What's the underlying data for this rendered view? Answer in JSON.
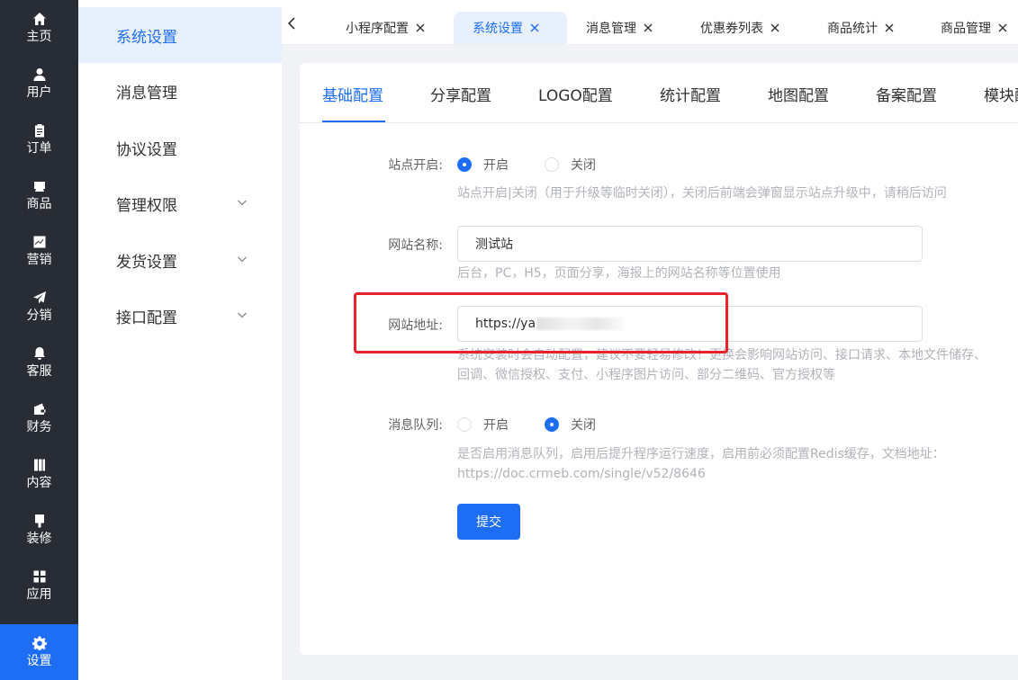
{
  "rail": {
    "items": [
      {
        "label": "主页",
        "icon": "home-icon"
      },
      {
        "label": "用户",
        "icon": "user-icon"
      },
      {
        "label": "订单",
        "icon": "clipboard-icon"
      },
      {
        "label": "商品",
        "icon": "product-icon"
      },
      {
        "label": "营销",
        "icon": "chart-icon"
      },
      {
        "label": "分销",
        "icon": "paper-plane-icon"
      },
      {
        "label": "客服",
        "icon": "bell-icon"
      },
      {
        "label": "财务",
        "icon": "wallet-icon"
      },
      {
        "label": "内容",
        "icon": "book-icon"
      },
      {
        "label": "装修",
        "icon": "brush-icon"
      },
      {
        "label": "应用",
        "icon": "apps-grid-icon"
      },
      {
        "label": "设置",
        "icon": "gear-icon",
        "active": true
      }
    ]
  },
  "submenu": {
    "items": [
      {
        "label": "系统设置",
        "active": true
      },
      {
        "label": "消息管理"
      },
      {
        "label": "协议设置"
      },
      {
        "label": "管理权限",
        "expandable": true
      },
      {
        "label": "发货设置",
        "expandable": true
      },
      {
        "label": "接口配置",
        "expandable": true
      }
    ]
  },
  "tabs": [
    {
      "label": "小程序配置"
    },
    {
      "label": "系统设置",
      "active": true
    },
    {
      "label": "消息管理"
    },
    {
      "label": "优惠券列表"
    },
    {
      "label": "商品统计"
    },
    {
      "label": "商品管理"
    }
  ],
  "config_tabs": [
    {
      "label": "基础配置",
      "active": true
    },
    {
      "label": "分享配置"
    },
    {
      "label": "LOGO配置"
    },
    {
      "label": "统计配置"
    },
    {
      "label": "地图配置"
    },
    {
      "label": "备案配置"
    },
    {
      "label": "模块配"
    }
  ],
  "form": {
    "site_open": {
      "label": "站点开启:",
      "options": [
        "开启",
        "关闭"
      ],
      "selected": "开启",
      "hint": "站点开启|关闭（用于升级等临时关闭），关闭后前端会弹窗显示站点升级中，请稍后访问"
    },
    "site_name": {
      "label": "网站名称:",
      "value": "测试站",
      "hint": "后台，PC，H5，页面分享，海报上的网站名称等位置使用"
    },
    "site_url": {
      "label": "网站地址:",
      "value": "https://ya",
      "hint_line1": "系统安装时会自动配置，建议不要轻易修改！更换会影响网站访问、接口请求、本地文件储存、",
      "hint_line2": "回调、微信授权、支付、小程序图片访问、部分二维码、官方授权等"
    },
    "queue": {
      "label": "消息队列:",
      "options": [
        "开启",
        "关闭"
      ],
      "selected": "关闭",
      "hint_line1": "是否启用消息队列，启用后提升程序运行速度，启用前必须配置Redis缓存，文档地址：",
      "hint_line2": "https://doc.crmeb.com/single/v52/8646"
    },
    "submit_label": "提交"
  },
  "colors": {
    "accent": "#1d6ef5",
    "rail_bg": "#282c34",
    "highlight": "#e8232b"
  }
}
